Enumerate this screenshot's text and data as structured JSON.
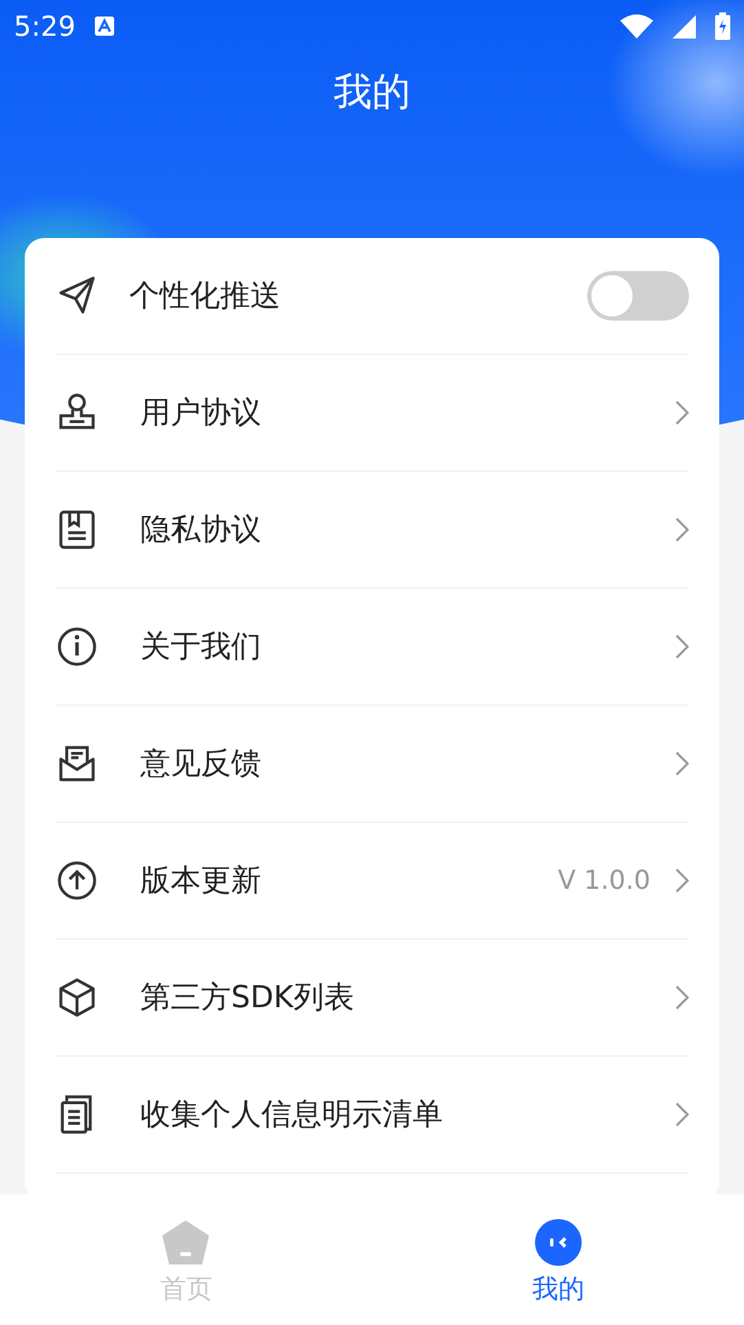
{
  "status_bar": {
    "time": "5:29"
  },
  "header": {
    "title": "我的"
  },
  "settings": [
    {
      "kind": "toggle",
      "label": "个性化推送",
      "on": false
    },
    {
      "kind": "link",
      "label": "用户协议"
    },
    {
      "kind": "link",
      "label": "隐私协议"
    },
    {
      "kind": "link",
      "label": "关于我们"
    },
    {
      "kind": "link",
      "label": "意见反馈"
    },
    {
      "kind": "link",
      "label": "版本更新",
      "value": "V 1.0.0"
    },
    {
      "kind": "link",
      "label": "第三方SDK列表"
    },
    {
      "kind": "link",
      "label": "收集个人信息明示清单"
    }
  ],
  "bottom_nav": [
    {
      "label": "首页",
      "selected": false
    },
    {
      "label": "我的",
      "selected": true
    }
  ]
}
